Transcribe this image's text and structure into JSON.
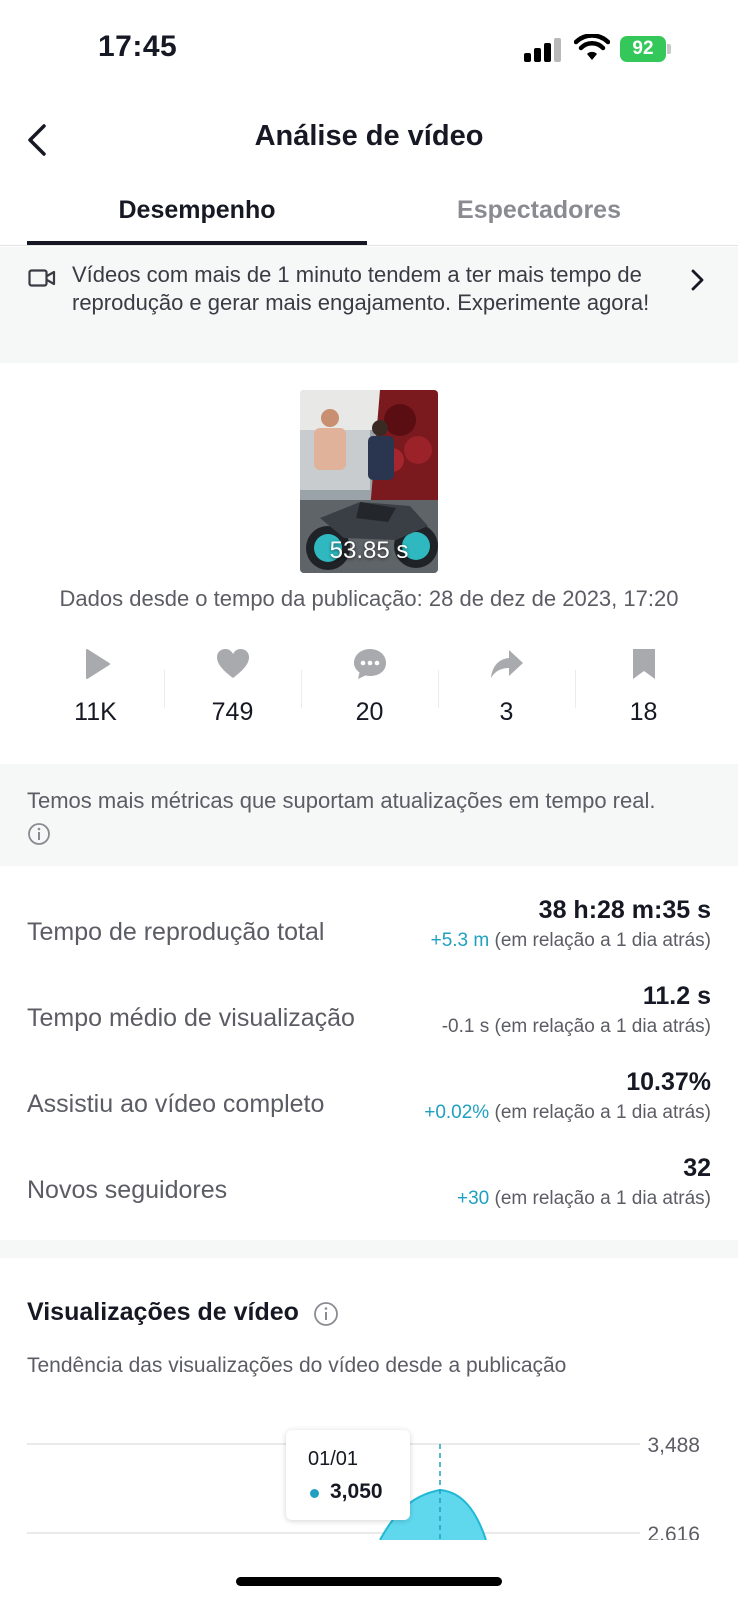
{
  "status_bar": {
    "time": "17:45",
    "battery": "92"
  },
  "nav": {
    "title": "Análise de vídeo"
  },
  "tabs": [
    {
      "label": "Desempenho",
      "active": true
    },
    {
      "label": "Espectadores",
      "active": false
    }
  ],
  "banner": {
    "text": "Vídeos com mais de 1 minuto tendem a ter mais tempo de reprodução e gerar mais engajamento. Experimente agora!"
  },
  "video": {
    "duration": "53.85 s",
    "published": "Dados desde o tempo da publicação: 28 de dez de 2023, 17:20"
  },
  "stats": [
    {
      "icon": "play-icon",
      "value": "11K"
    },
    {
      "icon": "heart-icon",
      "value": "749"
    },
    {
      "icon": "comment-icon",
      "value": "20"
    },
    {
      "icon": "share-icon",
      "value": "3"
    },
    {
      "icon": "bookmark-icon",
      "value": "18"
    }
  ],
  "notice": {
    "text": "Temos mais métricas que suportam atualizações em tempo real."
  },
  "metrics": [
    {
      "label": "Tempo de reprodução total",
      "value": "38 h:28 m:35 s",
      "delta": "+5.3 m",
      "delta_sign": "pos",
      "compare": "(em relação a 1 dia atrás)"
    },
    {
      "label": "Tempo médio de visualização",
      "value": "11.2 s",
      "delta": "-0.1 s",
      "delta_sign": "neg",
      "compare": "(em relação a 1 dia atrás)"
    },
    {
      "label": "Assistiu ao vídeo completo",
      "value": "10.37%",
      "delta": "+0.02%",
      "delta_sign": "pos",
      "compare": "(em relação a 1 dia atrás)"
    },
    {
      "label": "Novos seguidores",
      "value": "32",
      "delta": "+30",
      "delta_sign": "pos",
      "compare": "(em relação a 1 dia atrás)"
    }
  ],
  "chart": {
    "title": "Visualizações de vídeo",
    "subtitle": "Tendência das visualizações do vídeo desde a publicação",
    "y_ticks": [
      "3,488",
      "2,616"
    ],
    "tooltip": {
      "date": "01/01",
      "value": "3,050"
    }
  },
  "colors": {
    "accent": "#20a0c0",
    "area_fill": "#5fd8ee",
    "positive": "#20a0c0",
    "battery": "#34c759"
  }
}
